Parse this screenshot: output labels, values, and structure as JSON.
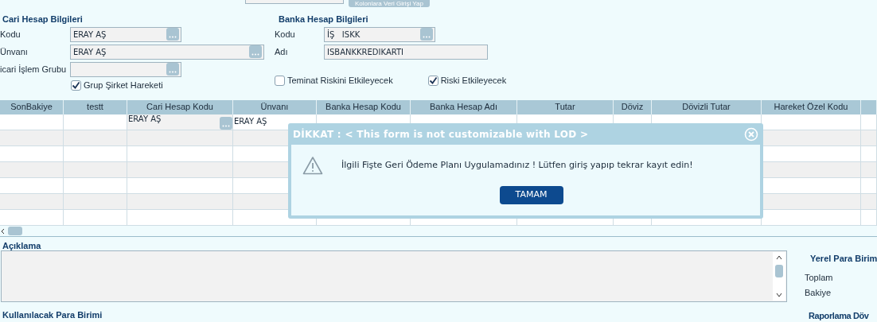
{
  "top_button": "Kolonlara Veri Girişi Yap",
  "cari": {
    "title": "Cari Hesap Bilgileri",
    "fields": [
      {
        "label": "Kodu",
        "value": "ERAY AŞ",
        "kind": "lookup"
      },
      {
        "label": "Ünvanı",
        "value": "ERAY AŞ",
        "kind": "lookup_wide"
      },
      {
        "label": "icari İşlem Grubu",
        "kind": "lookup"
      }
    ],
    "checkbox": {
      "label": "Grup Şirket Hareketi",
      "checked": true
    }
  },
  "banka": {
    "title": "Banka Hesap Bilgileri",
    "fields": [
      {
        "label": "Kodu",
        "value": "İŞ   ISKK",
        "kind": "lookup"
      },
      {
        "label": "Adı",
        "value": "ISBANKKREDIKARTI",
        "kind": "text"
      }
    ],
    "checkboxes": [
      {
        "label": "Teminat Riskini Etkileyecek",
        "checked": false
      },
      {
        "label": "Riski Etkileyecek",
        "checked": true
      }
    ]
  },
  "table": {
    "columns": [
      "SonBakiye",
      "testt",
      "Cari Hesap Kodu",
      "Ünvanı",
      "Banka Hesap Kodu",
      "Banka Hesap Adı",
      "Tutar",
      "Döviz",
      "Dövizli Tutar",
      "Hareket Özel Kodu"
    ],
    "rows": [
      [
        "",
        "",
        "ERAY AŞ",
        "ERAY AŞ",
        "",
        "",
        "",
        "",
        "",
        ""
      ]
    ]
  },
  "aciklama": {
    "title": "Açıklama"
  },
  "yerel": {
    "title": "Yerel Para Birim",
    "labels": [
      "Toplam",
      "Bakiye"
    ]
  },
  "kullanilacak": {
    "title": "Kullanılacak Para Birimi"
  },
  "raporlama": {
    "title": "Raporlama Döv"
  },
  "dialog": {
    "title": "DİKKAT : < This form is not customizable with LOD >",
    "message": "İlgili Fişte Geri Ödeme Planı Uygulamadınız ! Lütfen giriş yapıp tekrar kayıt edin!",
    "button": "TAMAM"
  }
}
